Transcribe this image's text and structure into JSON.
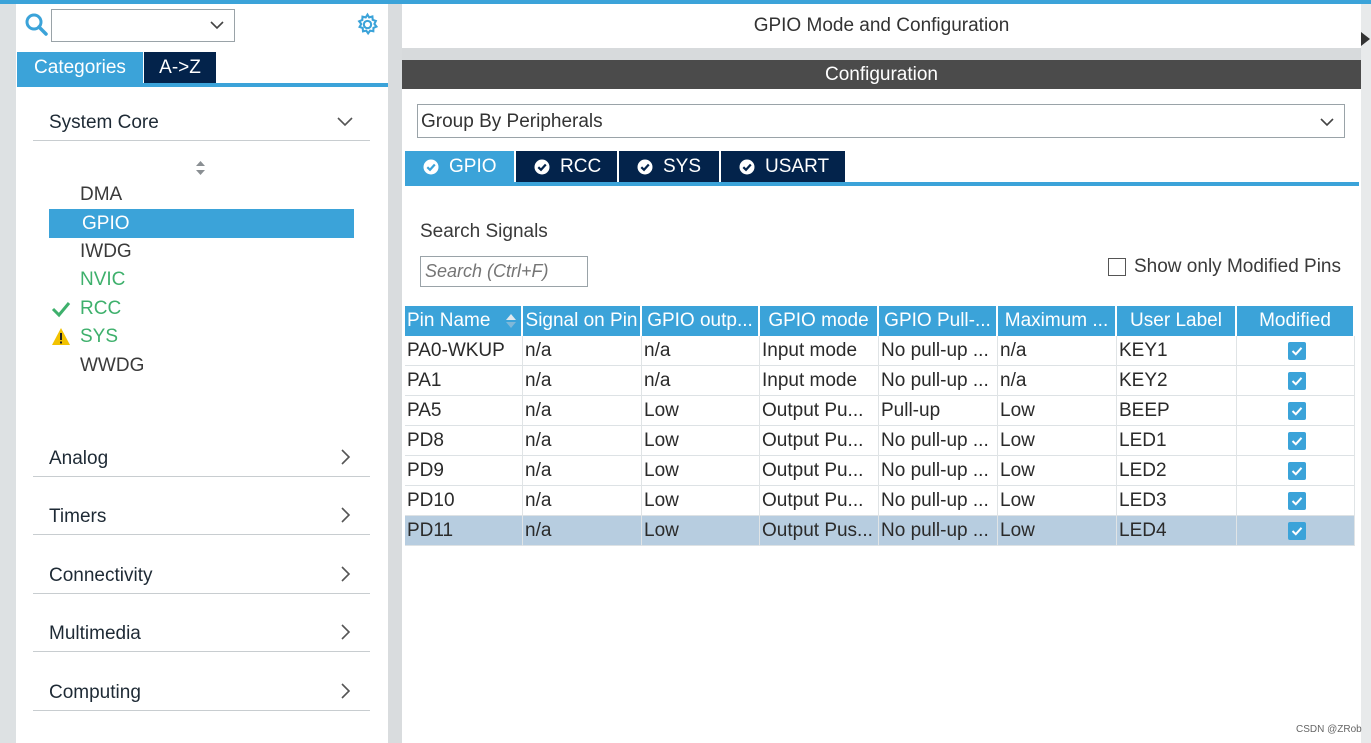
{
  "left": {
    "search_combo_value": "",
    "categories_tab": "Categories",
    "az_tab": "A->Z",
    "sections": [
      {
        "label": "System Core",
        "expanded": true
      },
      {
        "label": "Analog",
        "expanded": false
      },
      {
        "label": "Timers",
        "expanded": false
      },
      {
        "label": "Connectivity",
        "expanded": false
      },
      {
        "label": "Multimedia",
        "expanded": false
      },
      {
        "label": "Computing",
        "expanded": false
      }
    ],
    "system_core_items": [
      {
        "label": "DMA",
        "status": "none"
      },
      {
        "label": "GPIO",
        "status": "selected"
      },
      {
        "label": "IWDG",
        "status": "none"
      },
      {
        "label": "NVIC",
        "status": "enabled"
      },
      {
        "label": "RCC",
        "status": "ok"
      },
      {
        "label": "SYS",
        "status": "warning"
      },
      {
        "label": "WWDG",
        "status": "none"
      }
    ]
  },
  "right": {
    "title": "GPIO Mode and Configuration",
    "config_header": "Configuration",
    "group_by": "Group By Peripherals",
    "peripheral_tabs": [
      "GPIO",
      "RCC",
      "SYS",
      "USART"
    ],
    "active_tab": "GPIO",
    "search_label": "Search Signals",
    "search_placeholder": "Search (Ctrl+F)",
    "show_modified_label": "Show only Modified Pins",
    "show_modified_checked": false
  },
  "table": {
    "columns": [
      "Pin Name",
      "Signal on Pin",
      "GPIO outp...",
      "GPIO mode",
      "GPIO Pull-...",
      "Maximum ...",
      "User Label",
      "Modified"
    ],
    "rows": [
      {
        "pin": "PA0-WKUP",
        "signal": "n/a",
        "output": "n/a",
        "mode": "Input mode",
        "pull": "No pull-up ...",
        "speed": "n/a",
        "label": "KEY1",
        "modified": true
      },
      {
        "pin": "PA1",
        "signal": "n/a",
        "output": "n/a",
        "mode": "Input mode",
        "pull": "No pull-up ...",
        "speed": "n/a",
        "label": "KEY2",
        "modified": true
      },
      {
        "pin": "PA5",
        "signal": "n/a",
        "output": "Low",
        "mode": "Output Pu...",
        "pull": "Pull-up",
        "speed": "Low",
        "label": "BEEP",
        "modified": true
      },
      {
        "pin": "PD8",
        "signal": "n/a",
        "output": "Low",
        "mode": "Output Pu...",
        "pull": "No pull-up ...",
        "speed": "Low",
        "label": "LED1",
        "modified": true
      },
      {
        "pin": "PD9",
        "signal": "n/a",
        "output": "Low",
        "mode": "Output Pu...",
        "pull": "No pull-up ...",
        "speed": "Low",
        "label": "LED2",
        "modified": true
      },
      {
        "pin": "PD10",
        "signal": "n/a",
        "output": "Low",
        "mode": "Output Pu...",
        "pull": "No pull-up ...",
        "speed": "Low",
        "label": "LED3",
        "modified": true
      },
      {
        "pin": "PD11",
        "signal": "n/a",
        "output": "Low",
        "mode": "Output Pus...",
        "pull": "No pull-up ...",
        "speed": "Low",
        "label": "LED4",
        "modified": true
      }
    ],
    "selected_row": 6
  },
  "watermark": "CSDN @ZRob",
  "colors": {
    "accent": "#3ba3d9",
    "navy": "#03234b",
    "header_dark": "#4b4b4b",
    "status_green": "#3eb06c",
    "warning_yellow": "#f2c200",
    "selected_row": "#b7cde0"
  }
}
